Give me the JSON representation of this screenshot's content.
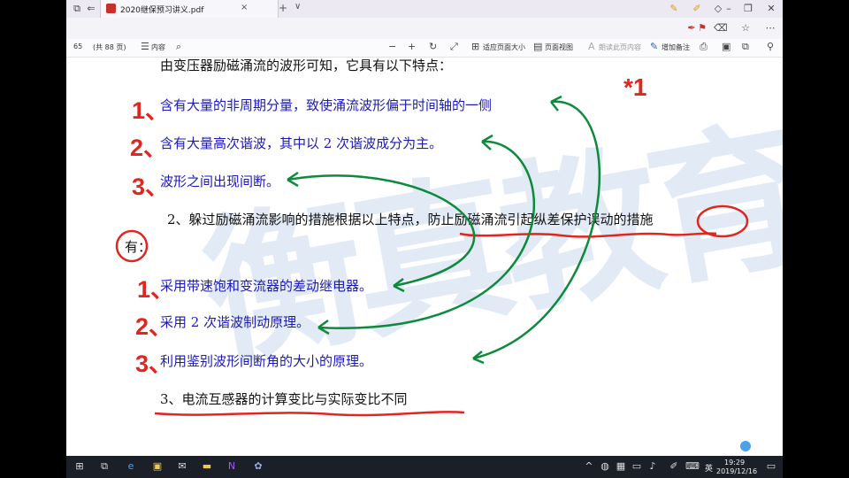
{
  "window": {
    "tab_title": "2020继保预习讲义.pdf",
    "tab_close": "×",
    "new_tab": "+",
    "tab_menu": "∨"
  },
  "toolbar": {
    "page_number": "65",
    "page_total": "(共 88 页)",
    "contents_label": "内容",
    "fit_label": "适应页面大小",
    "page_view_label": "页面视图",
    "read_aloud_label": "朗读此页内容",
    "annotate_label": "增加备注"
  },
  "document": {
    "heading_line": "由变压器励磁涌流的波形可知，它具有以下特点：",
    "features": [
      {
        "marker": "1、",
        "text": "含有大量的非周期分量，致使涌流波形偏于时间轴的一侧"
      },
      {
        "marker": "2、",
        "text": "含有大量高次谐波，其中以 2 次谐波成分为主。"
      },
      {
        "marker": "3、",
        "text": "波形之间出现间断。"
      }
    ],
    "measures_intro_1": "2、躲过励磁涌流影响的措施根据以上特点，防止励磁涌流引起纵差保护误动的措施",
    "measures_intro_2": "有：",
    "measures": [
      {
        "marker": "1、",
        "text": "采用带速饱和变流器的差动继电器。"
      },
      {
        "marker": "2、",
        "text": "采用 2 次谐波制动原理。"
      },
      {
        "marker": "3、",
        "text": "利用鉴别波形间断角的大小的原理。"
      }
    ],
    "section_3": "3、电流互感器的计算变比与实际变比不同",
    "handwritten_note": "*1",
    "watermark": "衡真教育"
  },
  "colors": {
    "printed_blue": "#1a1ab8",
    "marker_red": "#e0261f",
    "arrow_green": "#0d8a3c",
    "watermark_blue": "#dce6f3"
  },
  "taskbar": {
    "ime_label": "英",
    "time": "19:29",
    "date": "2019/12/16"
  }
}
